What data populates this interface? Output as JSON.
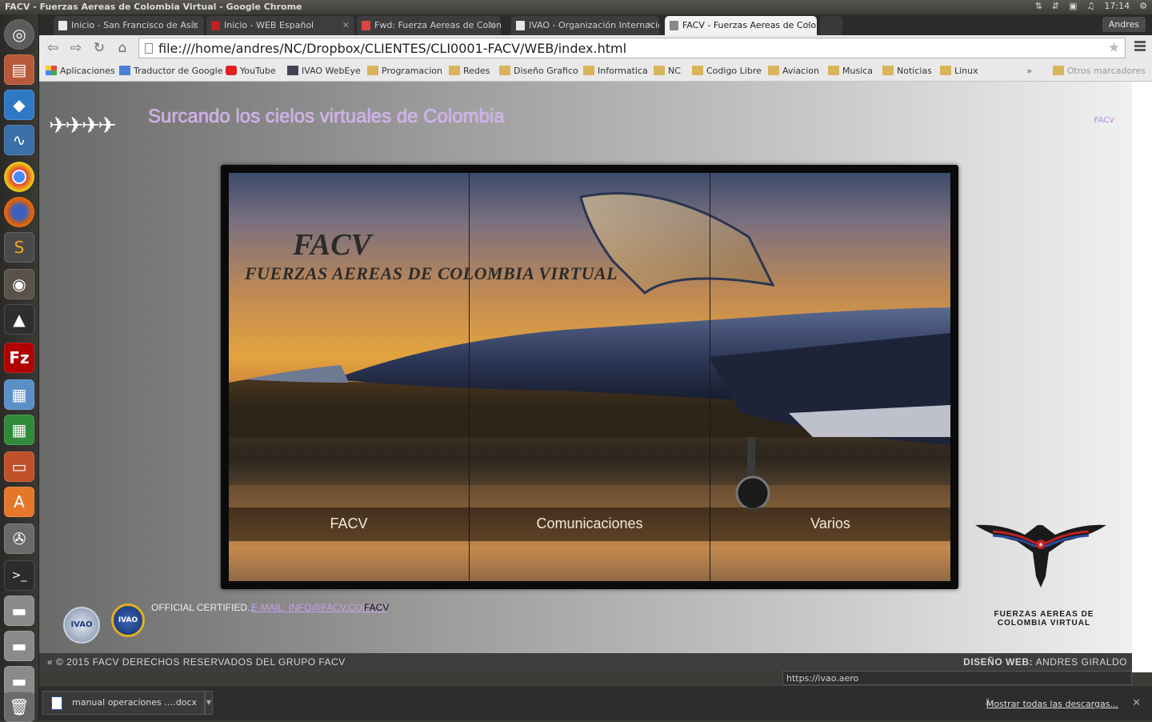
{
  "window": {
    "title": "FACV - Fuerzas Aereas de Colombia Virtual - Google Chrome",
    "time": "17:14",
    "tray_icons": [
      "network-icon",
      "transfer-icon",
      "battery-icon",
      "volume-icon",
      "settings-icon"
    ]
  },
  "launcher": {
    "items": [
      "ubuntu-dash-icon",
      "file-manager-icon",
      "dropbox-icon",
      "system-monitor-icon",
      "chrome-icon",
      "firefox-icon",
      "sublime-text-icon",
      "gimp-icon",
      "inkscape-icon",
      "filezilla-icon",
      "image-viewer-icon",
      "spreadsheet-icon",
      "presentation-icon",
      "software-center-icon",
      "system-settings-icon",
      "terminal-icon",
      "drive-icon",
      "drive-icon",
      "drive-icon",
      "trash-icon"
    ]
  },
  "browser": {
    "tabs": [
      {
        "label": "Inicio - San Francisco de Asís"
      },
      {
        "label": "Inicio - WEB Español"
      },
      {
        "label": "Fwd: Fuerza Aereas de Colombia"
      },
      {
        "label": "IVAO - Organización Internacional"
      },
      {
        "label": "FACV - Fuerzas Aereas de Colombia"
      }
    ],
    "user": "Andres",
    "url": "file:///home/andres/NC/Dropbox/CLIENTES/CLI0001-FACV/WEB/index.html",
    "bookmarks": [
      {
        "label": "Aplicaciones",
        "icon": "apps-grid-icon"
      },
      {
        "label": "Traductor de Google",
        "icon": "translate-icon"
      },
      {
        "label": "YouTube",
        "icon": "youtube-icon"
      },
      {
        "label": "IVAO WebEye",
        "icon": "ivao-icon"
      },
      {
        "label": "Programacion",
        "icon": "folder-icon"
      },
      {
        "label": "Redes",
        "icon": "folder-icon"
      },
      {
        "label": "Diseño Grafico",
        "icon": "folder-icon"
      },
      {
        "label": "Informatica",
        "icon": "folder-icon"
      },
      {
        "label": "NC",
        "icon": "folder-icon"
      },
      {
        "label": "Codigo Libre",
        "icon": "folder-icon"
      },
      {
        "label": "Aviacion",
        "icon": "folder-icon"
      },
      {
        "label": "Musica",
        "icon": "folder-icon"
      },
      {
        "label": "Noticias",
        "icon": "folder-icon"
      },
      {
        "label": "Linux",
        "icon": "folder-icon"
      }
    ],
    "bookmarks_more": "»",
    "bookmarks_other": "Otros marcadores",
    "status_url": "https://ivao.aero"
  },
  "page": {
    "header_title": "Surcando los cielos virtuales de Colombia",
    "header_link": "FACV",
    "hero_title": "FACV",
    "hero_subtitle": "FUERZAS AEREAS DE COLOMBIA VIRTUAL",
    "menu": [
      "FACV",
      "Comunicaciones",
      "Varios"
    ],
    "emblem_text": "FUERZAS AEREAS DE COLOMBIA VIRTUAL",
    "footer_links": {
      "ivao_logo": "IVAO",
      "ivao_colombia_logo": "IVAO",
      "certified": "OFFICIAL CERTIFIED…",
      "email": "E-MAIL: INFO@FACV.COM.CO",
      "facv": "FACV"
    },
    "bottom_bar": {
      "copyright": "« © 2015 FACV DERECHOS RESERVADOS DEL GRUPO FACV",
      "design_label": "DISEÑO WEB:",
      "designer": "ANDRES GIRALDO"
    }
  },
  "download_shelf": {
    "file": "manual operaciones ….docx",
    "show_all": "Mostrar todas las descargas..."
  }
}
